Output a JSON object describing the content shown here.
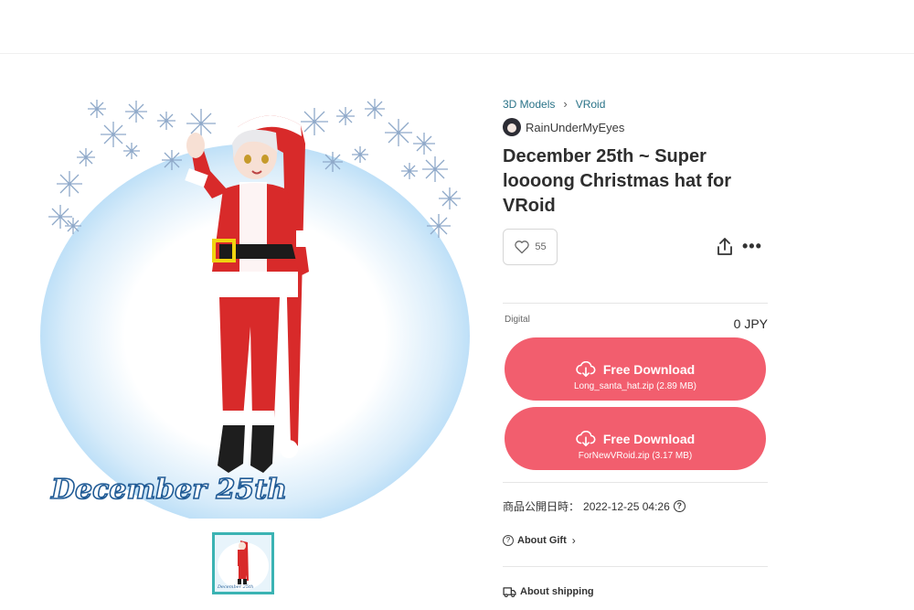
{
  "breadcrumb": {
    "items": [
      "3D Models",
      "VRoid"
    ],
    "separator": ">"
  },
  "shop": {
    "name": "RainUnderMyEyes"
  },
  "product": {
    "title": "December 25th ~ Super loooong Christmas hat for VRoid",
    "likes": "55",
    "image_caption": "December 25th"
  },
  "variant": {
    "type": "Digital",
    "price": "0 JPY"
  },
  "downloads": [
    {
      "label": "Free Download",
      "file": "Long_santa_hat.zip (2.89 MB)"
    },
    {
      "label": "Free Download",
      "file": "ForNewVRoid.zip (3.17 MB)"
    }
  ],
  "meta": {
    "published_label": "商品公開日時：",
    "published_at": "2022-12-25 04:26",
    "about_gift": "About Gift",
    "about_shipping": "About shipping"
  },
  "colors": {
    "accent": "#f25e6e",
    "link": "#2a7388",
    "thumb_border": "#3bb3b3"
  },
  "icons": [
    "chevron-right-icon",
    "heart-icon",
    "share-icon",
    "more-icon",
    "cloud-download-icon",
    "question-icon",
    "gift-info-icon",
    "truck-icon"
  ]
}
